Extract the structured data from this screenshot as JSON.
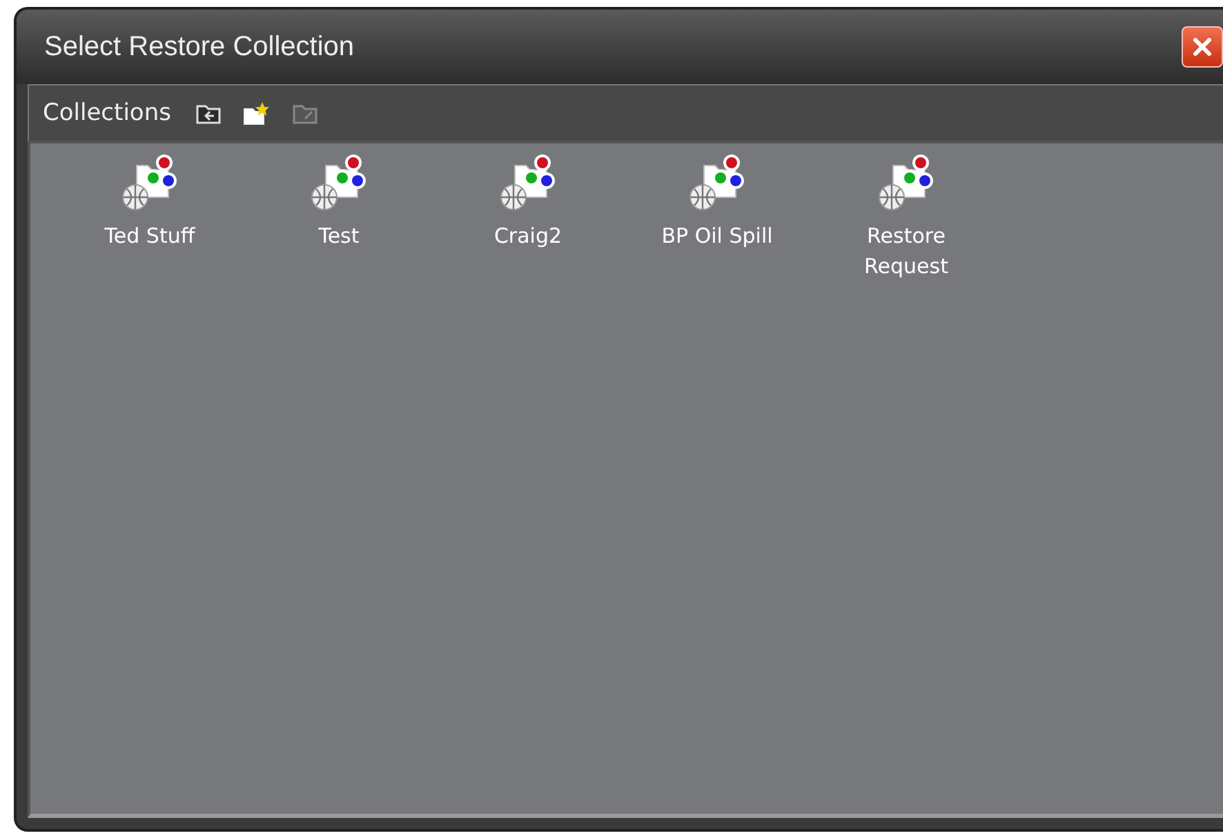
{
  "window": {
    "title": "Select Restore Collection"
  },
  "toolbar": {
    "label": "Collections"
  },
  "collections": [
    {
      "label": "Ted Stuff"
    },
    {
      "label": "Test"
    },
    {
      "label": "Craig2"
    },
    {
      "label": "BP Oil Spill"
    },
    {
      "label": "Restore\nRequest"
    }
  ]
}
